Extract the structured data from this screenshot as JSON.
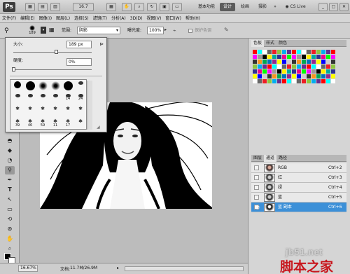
{
  "titlebar": {
    "app_logo": "Ps",
    "zoom": "16.7",
    "workspaces": [
      "基本功能",
      "设计",
      "绘画",
      "摄影"
    ],
    "active_workspace": "设计",
    "more": "»",
    "cs_live": "CS Live",
    "window_buttons": [
      "_",
      "□",
      "✕"
    ]
  },
  "menu": [
    "文件(F)",
    "编辑(E)",
    "图像(I)",
    "图层(L)",
    "选择(S)",
    "滤镜(T)",
    "分析(A)",
    "3D(D)",
    "视图(V)",
    "窗口(W)",
    "帮助(H)"
  ],
  "options": {
    "brush_size": "189",
    "range_label": "范围:",
    "range_value": "阴影",
    "exposure_label": "曝光度:",
    "exposure_value": "100%",
    "protect_label": "保护色调"
  },
  "brush_panel": {
    "size_label": "大小:",
    "size_value": "189 px",
    "hardness_label": "硬度:",
    "hardness_value": "0%",
    "presets": [
      {
        "shape": "hard",
        "label": ""
      },
      {
        "shape": "hard-lg",
        "label": ""
      },
      {
        "shape": "soft",
        "label": ""
      },
      {
        "shape": "soft",
        "label": ""
      },
      {
        "shape": "hard-lg",
        "label": ""
      },
      {
        "shape": "dot",
        "label": ""
      },
      {
        "shape": "dot",
        "label": ""
      },
      {
        "shape": "dot",
        "label": ""
      },
      {
        "shape": "dot",
        "label": ""
      },
      {
        "shape": "dot",
        "label": ""
      },
      {
        "shape": "dot",
        "label": "14"
      },
      {
        "shape": "dot",
        "label": "24"
      },
      {
        "shape": "star",
        "label": ""
      },
      {
        "shape": "star",
        "label": ""
      },
      {
        "shape": "star",
        "label": ""
      },
      {
        "shape": "star",
        "label": ""
      },
      {
        "shape": "star",
        "label": ""
      },
      {
        "shape": "star",
        "label": ""
      },
      {
        "shape": "star",
        "label": "39"
      },
      {
        "shape": "star",
        "label": "46"
      },
      {
        "shape": "star",
        "label": "59"
      },
      {
        "shape": "star",
        "label": "11"
      },
      {
        "shape": "star",
        "label": "17"
      },
      {
        "shape": "star",
        "label": ""
      }
    ]
  },
  "status": {
    "zoom": "16.67%",
    "doc_label": "文档:",
    "doc_size": "11.7M/26.9M"
  },
  "swatches_tabs": [
    "色板",
    "样式",
    "颜色"
  ],
  "channels_tabs": [
    "图层",
    "通道",
    "路径"
  ],
  "channels": [
    {
      "name": "RGB",
      "shortcut": "Ctrl+2",
      "thumb": "rgb"
    },
    {
      "name": "红",
      "shortcut": "Ctrl+3",
      "thumb": "gray"
    },
    {
      "name": "绿",
      "shortcut": "Ctrl+4",
      "thumb": "gray"
    },
    {
      "name": "蓝",
      "shortcut": "Ctrl+5",
      "thumb": "gray"
    },
    {
      "name": "蓝 副本",
      "shortcut": "Ctrl+6",
      "thumb": "mask",
      "selected": true
    }
  ],
  "watermark": {
    "line1": "jb51.net",
    "line2": "脚本之家"
  },
  "colors": {
    "selection_blue": "#3c90d8",
    "watermark_red": "#c8161d"
  }
}
